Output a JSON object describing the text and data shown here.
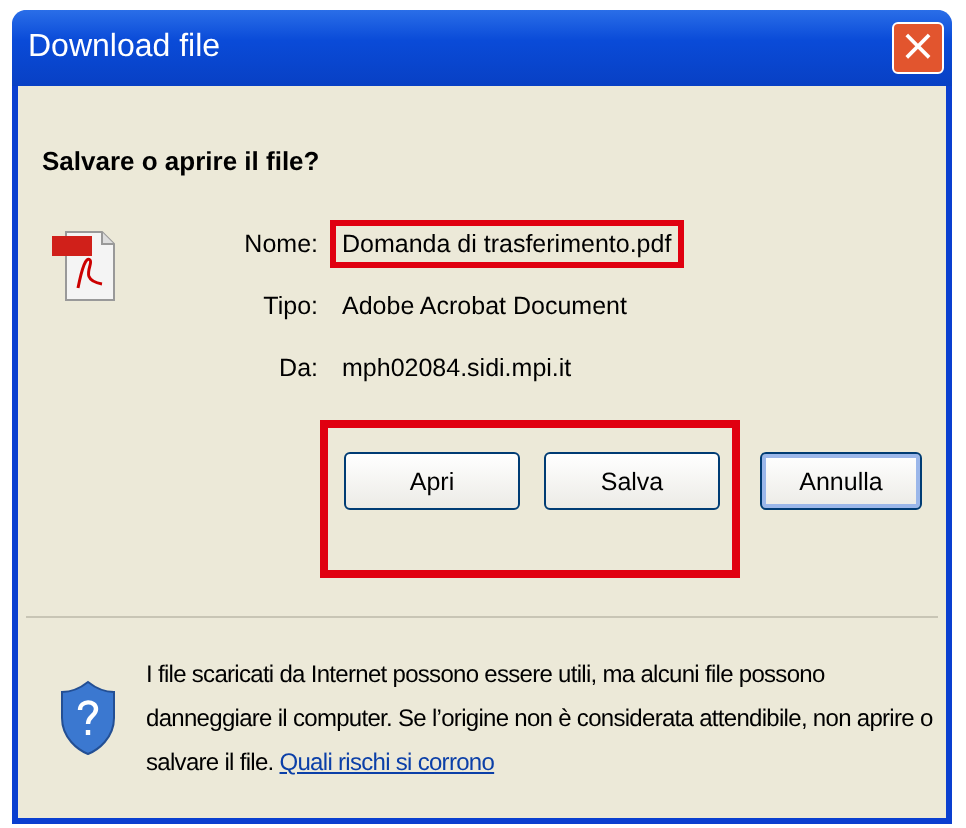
{
  "window": {
    "title": "Download file",
    "close": "×"
  },
  "question": "Salvare o aprire il file?",
  "fields": [
    {
      "label": "Nome:",
      "value": "Domanda di trasferimento.pdf",
      "highlighted": true
    },
    {
      "label": "Tipo:",
      "value": "Adobe Acrobat Document",
      "highlighted": false
    },
    {
      "label": "Da:",
      "value": "mph02084.sidi.mpi.it",
      "highlighted": false
    }
  ],
  "buttons": [
    {
      "label": "Apri",
      "highlighted": true
    },
    {
      "label": "Salva",
      "highlighted": true
    },
    {
      "label": "Annulla",
      "highlighted": false
    }
  ],
  "warning": {
    "text": "I file scaricati da Internet possono essere utili, ma alcuni file possono danneggiare il computer. Se l’origine non è considerata attendibile, non aprire o salvare il file.",
    "link": "Quali rischi si corrono"
  }
}
